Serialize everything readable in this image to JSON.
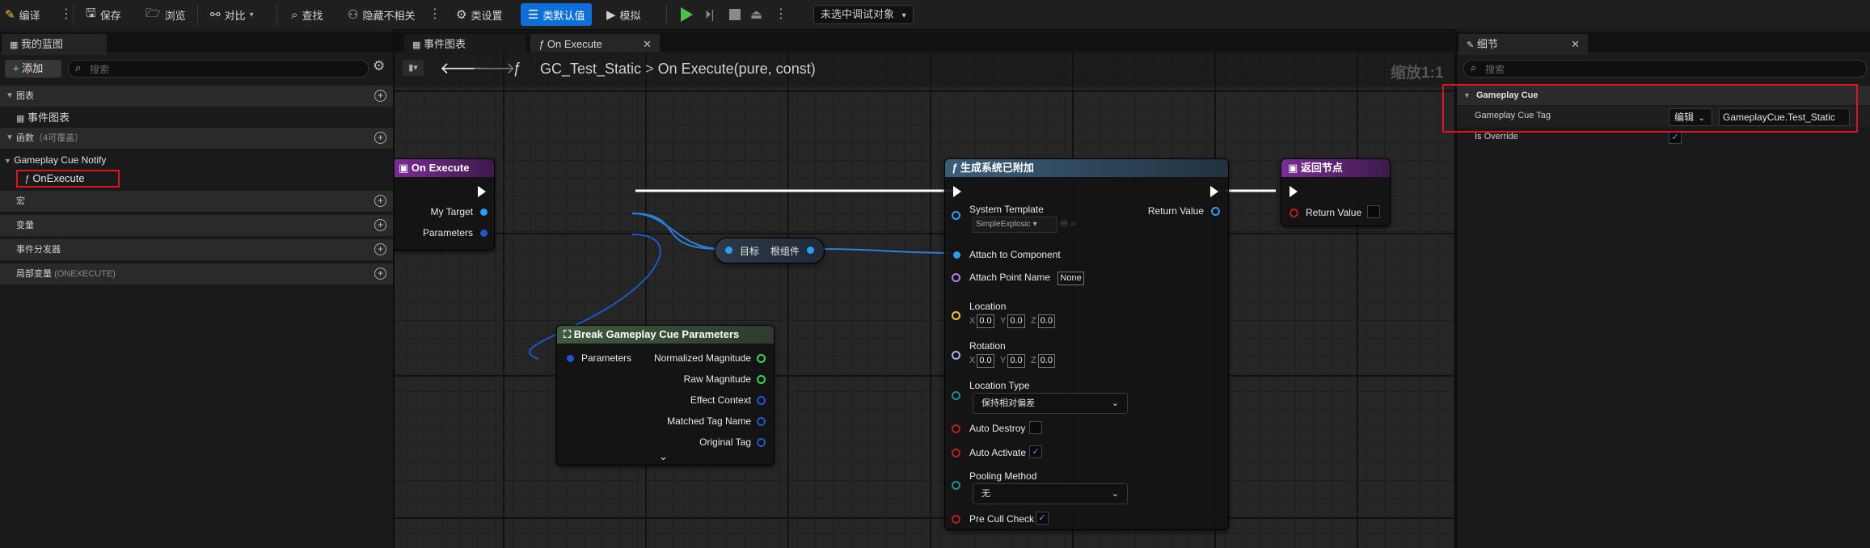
{
  "toolbar": {
    "compile": "编译",
    "save": "保存",
    "browse": "浏览",
    "diff": "对比",
    "find": "查找",
    "hide_unrelated": "隐藏不相关",
    "class_settings": "类设置",
    "class_defaults": "类默认值",
    "simulate": "模拟",
    "debug_target": "未选中调试对象"
  },
  "left_panel": {
    "tab_title": "我的蓝图",
    "add_button": "添加",
    "search_placeholder": "搜索",
    "sections": {
      "graphs": "图表",
      "event_graph_item": "事件图表",
      "functions": "函数",
      "functions_count": "（4可覆盖）",
      "gameplay_cue_notify": "Gameplay Cue Notify",
      "on_execute_item": "OnExecute",
      "macros": "宏",
      "variables": "变量",
      "event_dispatchers": "事件分发器",
      "local_variables": "局部变量",
      "local_variables_suffix": "(ONEXECUTE)"
    }
  },
  "tabs": {
    "event_graph": "事件图表",
    "on_execute": "On Execute"
  },
  "graph": {
    "breadcrumb_class": "GC_Test_Static",
    "breadcrumb_func": "On Execute(pure, const)",
    "zoom": "缩放1:1",
    "node_on_execute": {
      "title": "On Execute",
      "pin_my_target": "My Target",
      "pin_parameters": "Parameters"
    },
    "node_root_component": {
      "pin_target": "目标",
      "pin_root": "根组件"
    },
    "node_spawn_system": {
      "title": "生成系统已附加",
      "system_template": "System Template",
      "system_template_value": "SimpleExplosic",
      "return_value": "Return Value",
      "attach_to_component": "Attach to Component",
      "attach_point_name": "Attach Point Name",
      "attach_point_value": "None",
      "location": "Location",
      "rotation": "Rotation",
      "axis_x": "X",
      "axis_y": "Y",
      "axis_z": "Z",
      "zero": "0.0",
      "location_type": "Location Type",
      "location_type_value": "保持相对偏差",
      "auto_destroy": "Auto Destroy",
      "auto_activate": "Auto Activate",
      "pooling_method": "Pooling Method",
      "pooling_value": "无",
      "pre_cull_check": "Pre Cull Check"
    },
    "node_return": {
      "title": "返回节点",
      "return_value": "Return Value"
    },
    "node_break": {
      "title": "Break Gameplay Cue Parameters",
      "parameters": "Parameters",
      "normalized_magnitude": "Normalized Magnitude",
      "raw_magnitude": "Raw Magnitude",
      "effect_context": "Effect Context",
      "matched_tag_name": "Matched Tag Name",
      "original_tag": "Original Tag"
    }
  },
  "details": {
    "tab_title": "细节",
    "search_placeholder": "搜索",
    "category": "Gameplay Cue",
    "gameplay_cue_tag_label": "Gameplay Cue Tag",
    "edit_button": "编辑",
    "gameplay_cue_tag_value": "GameplayCue.Test_Static",
    "is_override_label": "Is Override"
  }
}
